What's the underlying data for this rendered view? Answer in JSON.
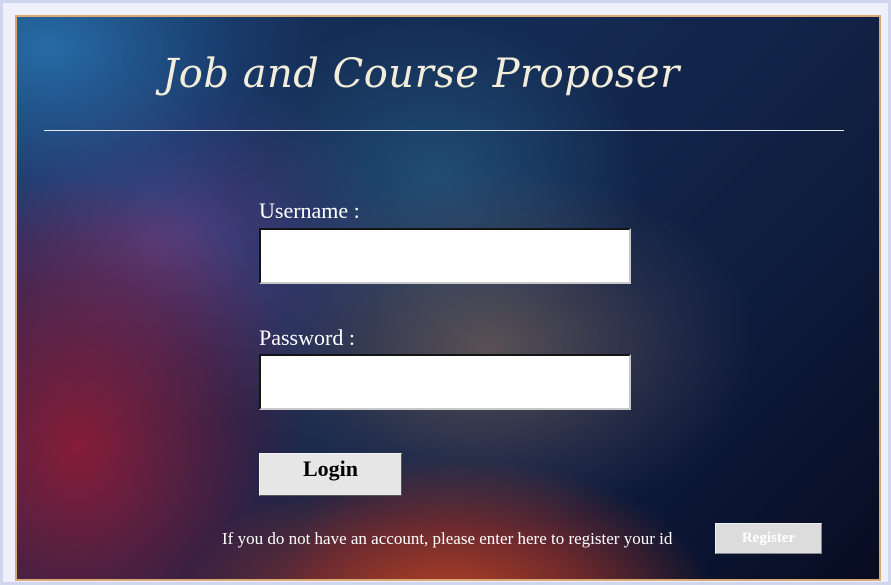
{
  "app": {
    "title": "Job and Course Proposer"
  },
  "login_form": {
    "username_label": "Username :",
    "username_value": "",
    "password_label": "Password :",
    "password_value": "",
    "login_label": "Login"
  },
  "register": {
    "prompt": "If you do not have an account, please enter here to register your id",
    "button_label": "Register"
  },
  "colors": {
    "title_text": "#f3eedb",
    "panel_border": "#d9a873",
    "frame_border": "#cfd6ee",
    "button_face": "#e6e6e6"
  }
}
